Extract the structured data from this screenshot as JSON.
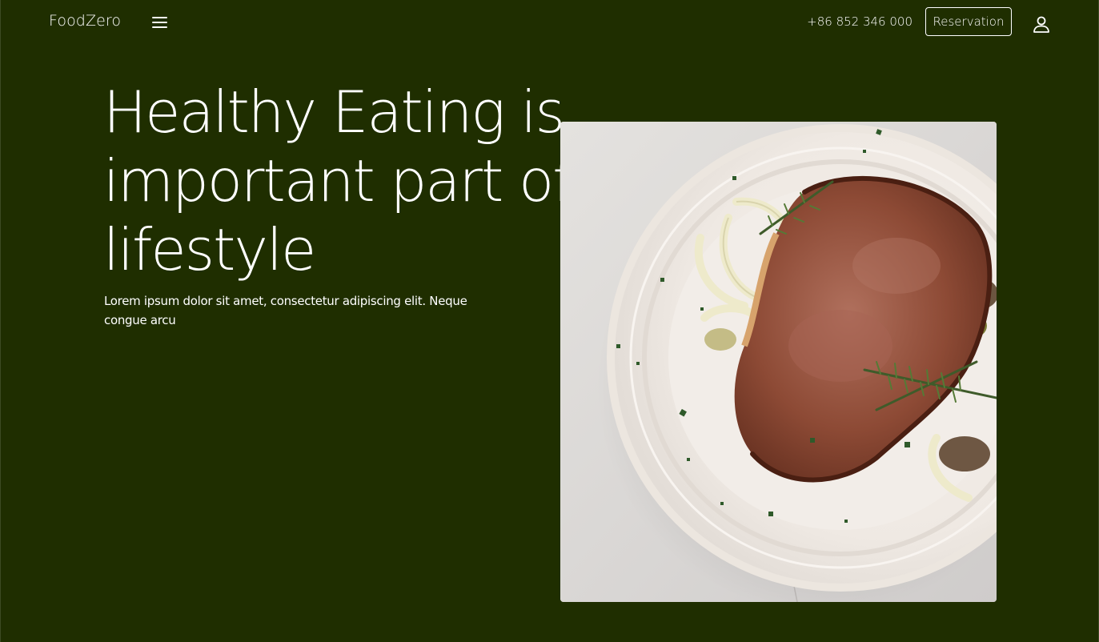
{
  "header": {
    "brand": "FoodZero",
    "menu_icon": "hamburger-menu-icon",
    "phone": "+86 852 346 000",
    "reservation_label": "Reservation",
    "user_icon": "user-icon"
  },
  "hero": {
    "title": "Healthy Eating is important part of lifestyle",
    "subtitle": "Lorem ipsum dolor sit amet, consectetur adipiscing elit. Neque congue arcu"
  },
  "colors": {
    "background": "#1f2e00",
    "text": "#ffffff"
  }
}
